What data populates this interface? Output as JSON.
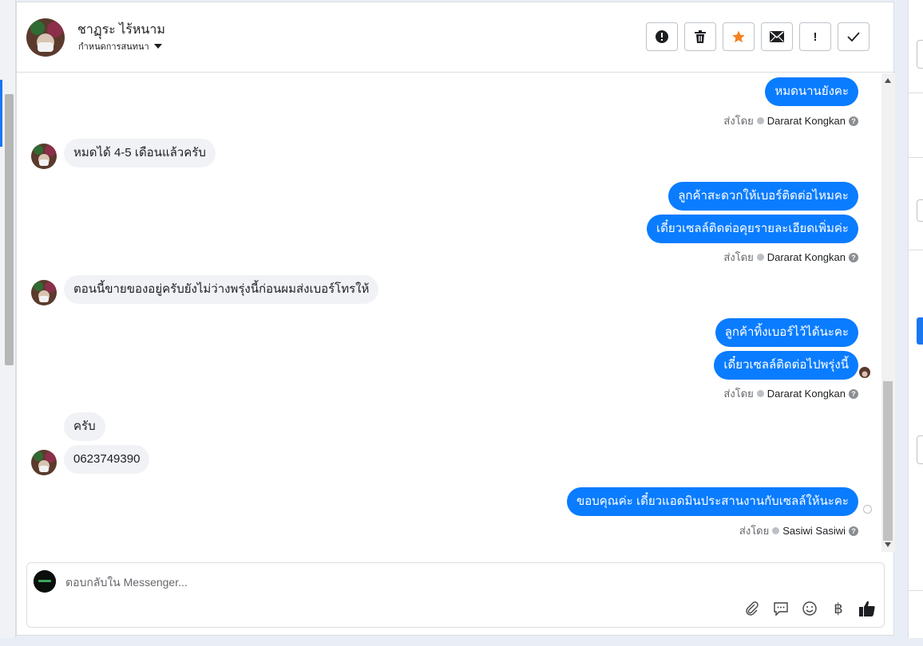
{
  "contact": {
    "name": "ชาฏุระ ไร้หนาม",
    "assign_label": "กำหนดการสนทนา"
  },
  "toolbar": {
    "buttons": [
      {
        "name": "alert-icon",
        "glyph": "!"
      },
      {
        "name": "trash-icon",
        "glyph": "🗑"
      },
      {
        "name": "star-icon",
        "glyph": "★"
      },
      {
        "name": "mail-icon",
        "glyph": "✉"
      },
      {
        "name": "exclamation-icon",
        "glyph": "!"
      },
      {
        "name": "check-icon",
        "glyph": "✓"
      }
    ]
  },
  "messages": {
    "m1": "หมดนานยังคะ",
    "sent1": {
      "prefix": "ส่งโดย",
      "agent": "Dararat Kongkan"
    },
    "m2": "หมดได้ 4-5 เดือนแล้วครับ",
    "m3": "ลูกค้าสะดวกให้เบอร์ติดต่อไหมคะ",
    "m4": "เดี๋ยวเซลล์ติดต่อคุยรายละเอียดเพิ่มค่ะ",
    "sent2": {
      "prefix": "ส่งโดย",
      "agent": "Dararat Kongkan"
    },
    "m5": "ตอนนี้ขายของอยู่ครับยังไม่ว่างพรุ่งนี้ก่อนผมส่งเบอร์โทรให้",
    "m6": "ลูกค้าทิ้งเบอร์ไว้ได้นะคะ",
    "m7": "เดี๋ยวเซลล์ติดต่อไปพรุ่งนี้",
    "sent3": {
      "prefix": "ส่งโดย",
      "agent": "Dararat Kongkan"
    },
    "m8": "ครับ",
    "m9": "0623749390",
    "m10": "ขอบคุณค่ะ เดี๋ยวแอดมินประสานงานกับเซลล์ให้นะคะ",
    "sent4": {
      "prefix": "ส่งโดย",
      "agent": "Sasiwi Sasiwi"
    }
  },
  "composer": {
    "placeholder": "ตอบกลับใน Messenger..."
  },
  "composer_tools": [
    "paperclip-icon",
    "chat-bubble-icon",
    "smiley-icon",
    "baht-icon",
    "thumbs-up-icon"
  ],
  "colors": {
    "outgoing_bubble": "#0a7cff",
    "incoming_bubble": "#f0f2f5",
    "star": "#f5821f"
  }
}
